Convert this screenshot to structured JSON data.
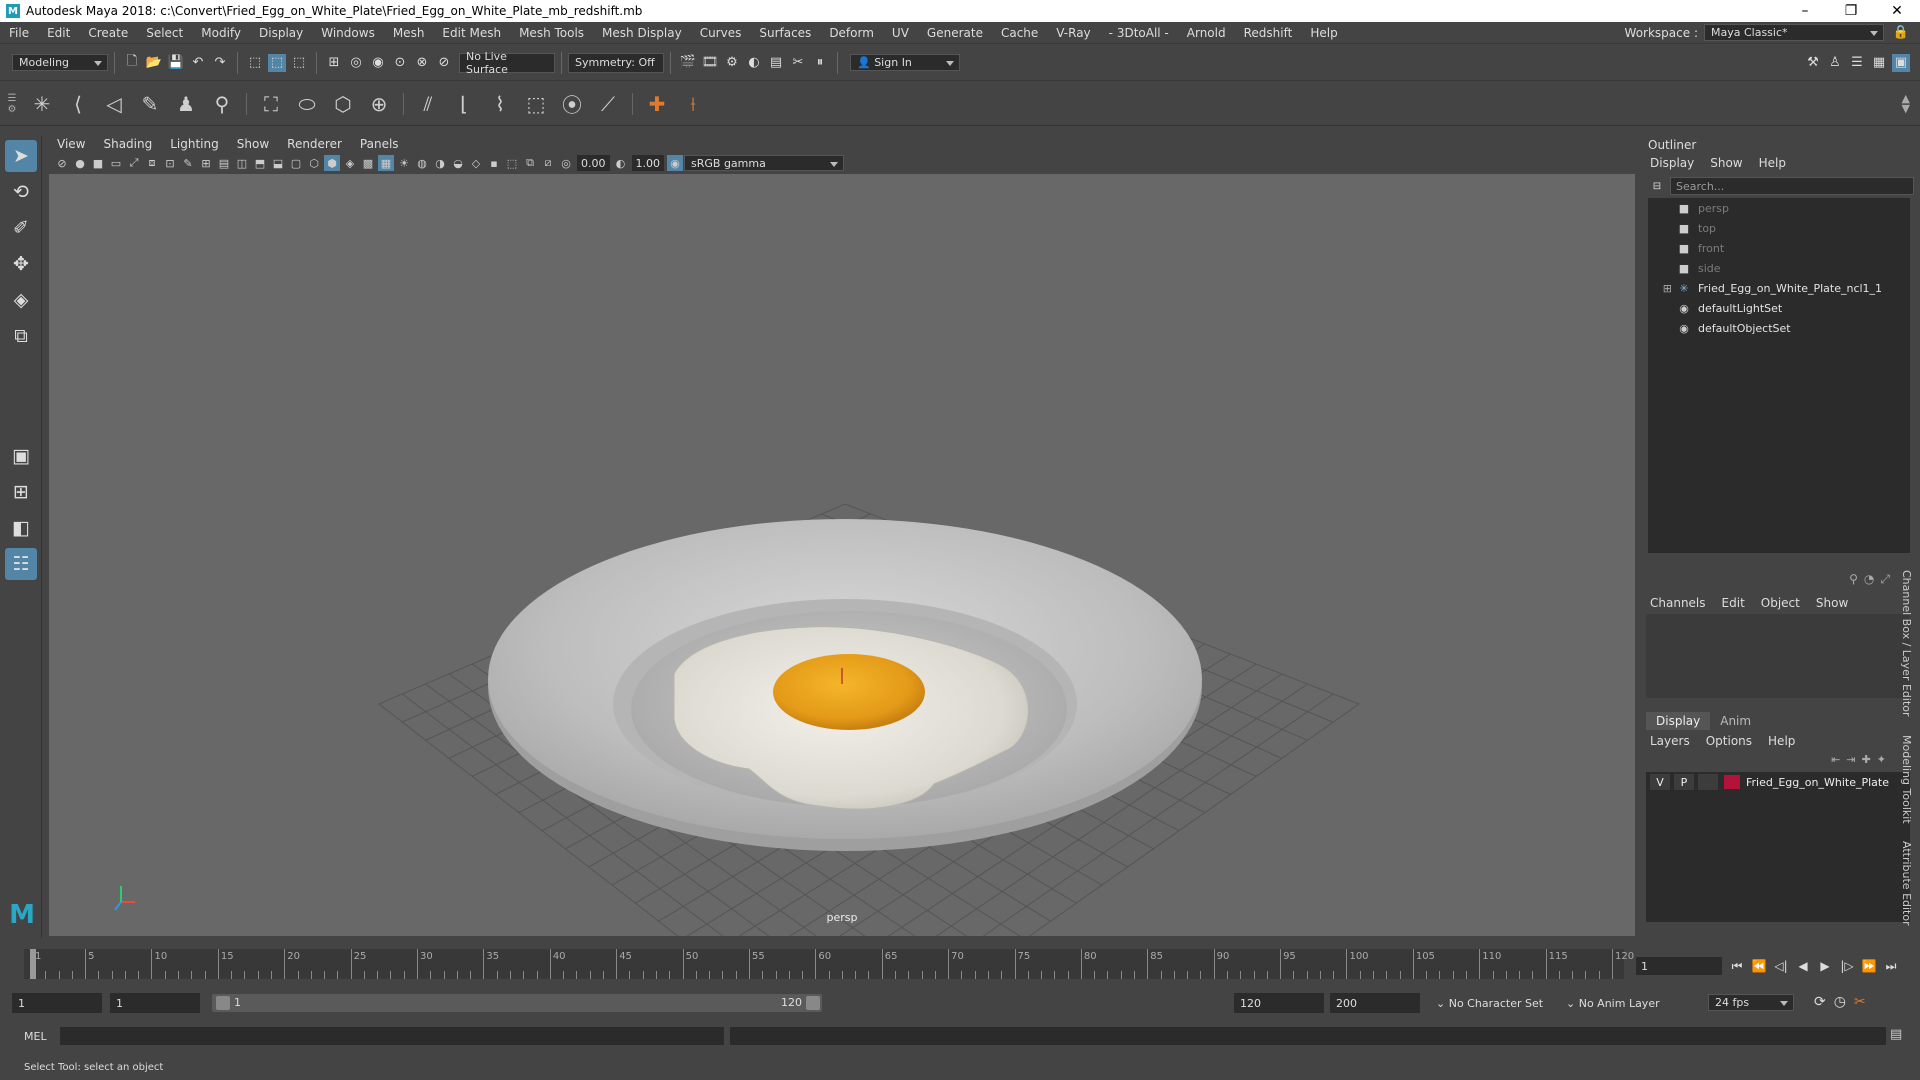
{
  "window": {
    "title": "Autodesk Maya 2018: c:\\Convert\\Fried_Egg_on_White_Plate\\Fried_Egg_on_White_Plate_mb_redshift.mb",
    "logo": "M",
    "minimize": "–",
    "maximize": "❐",
    "close": "✕"
  },
  "menubar": {
    "items": [
      "File",
      "Edit",
      "Create",
      "Select",
      "Modify",
      "Display",
      "Windows",
      "Mesh",
      "Edit Mesh",
      "Mesh Tools",
      "Mesh Display",
      "Curves",
      "Surfaces",
      "Deform",
      "UV",
      "Generate",
      "Cache",
      "V-Ray",
      "- 3DtoAll -",
      "Arnold",
      "Redshift",
      "Help"
    ],
    "workspace_label": "Workspace :",
    "workspace_value": "Maya Classic*"
  },
  "statusline": {
    "menu_set": "Modeling",
    "live_surface": "No Live Surface",
    "symmetry": "Symmetry: Off",
    "sign_in": "Sign In"
  },
  "viewport": {
    "menu": [
      "View",
      "Shading",
      "Lighting",
      "Show",
      "Renderer",
      "Panels"
    ],
    "exposure": "0.00",
    "gamma": "1.00",
    "color_space": "sRGB gamma",
    "camera": "persp"
  },
  "outliner": {
    "title": "Outliner",
    "menu": [
      "Display",
      "Show",
      "Help"
    ],
    "search_placeholder": "Search...",
    "items": [
      {
        "label": "persp",
        "dim": true,
        "icon": "camera-icon"
      },
      {
        "label": "top",
        "dim": true,
        "icon": "camera-icon"
      },
      {
        "label": "front",
        "dim": true,
        "icon": "camera-icon"
      },
      {
        "label": "side",
        "dim": true,
        "icon": "camera-icon"
      },
      {
        "label": "Fried_Egg_on_White_Plate_ncl1_1",
        "dim": false,
        "icon": "group-icon",
        "expand": "⊞"
      },
      {
        "label": "defaultLightSet",
        "dim": false,
        "icon": "set-icon"
      },
      {
        "label": "defaultObjectSet",
        "dim": false,
        "icon": "set-icon"
      }
    ]
  },
  "channelbox": {
    "menu": [
      "Channels",
      "Edit",
      "Object",
      "Show"
    ]
  },
  "layereditor": {
    "tabs": [
      "Display",
      "Anim"
    ],
    "menu": [
      "Layers",
      "Options",
      "Help"
    ],
    "layer": {
      "v": "V",
      "p": "P",
      "name": "Fried_Egg_on_White_Plate",
      "color": "#b3123a"
    }
  },
  "sidetabs": [
    "Channel Box / Layer Editor",
    "Modeling Toolkit",
    "Attribute Editor"
  ],
  "timeline": {
    "start": 1,
    "end": 120,
    "labels": [
      1,
      5,
      10,
      15,
      20,
      25,
      30,
      35,
      40,
      45,
      50,
      55,
      60,
      65,
      70,
      75,
      80,
      85,
      90,
      95,
      100,
      105,
      110,
      115,
      120
    ],
    "current_frame": "1"
  },
  "range": {
    "anim_start": "1",
    "playback_start": "1",
    "slider_start": "1",
    "slider_end": "120",
    "playback_end": "120",
    "anim_end": "200",
    "character_set": "No Character Set",
    "anim_layer": "No Anim Layer",
    "fps": "24 fps"
  },
  "cmdline": {
    "label": "MEL"
  },
  "helpline": {
    "text": "Select Tool: select an object"
  },
  "colors": {
    "active": "#5285a6",
    "viewport": "#686868",
    "yolk": "#e6a21c"
  }
}
